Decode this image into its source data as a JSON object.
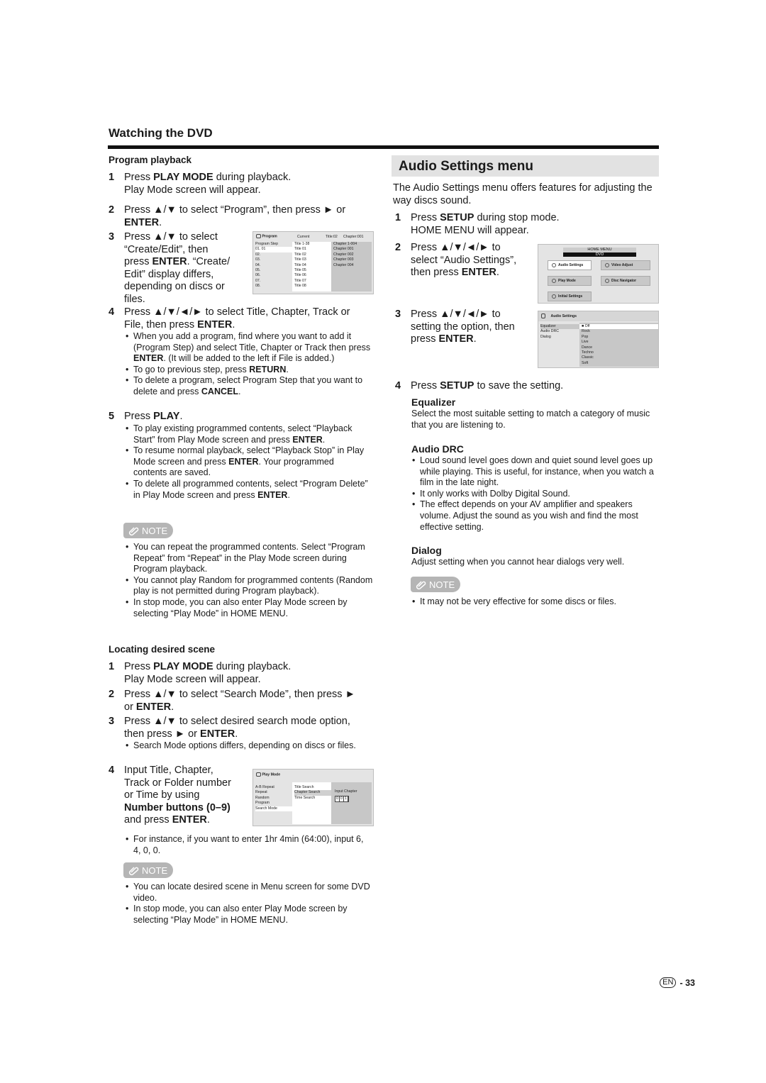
{
  "section_title": "Watching the DVD",
  "program_playback": {
    "title": "Program playback",
    "steps": [
      {
        "num": "1",
        "html": "Press <b>PLAY MODE</b> during playback.<br>Play Mode screen will appear."
      },
      {
        "num": "2",
        "html": "Press ▲/▼ to select “Program”, then press ► or<br><b>ENTER</b>."
      },
      {
        "num": "3",
        "html": "Press ▲/▼ to select<br>“Create/Edit”, then<br>press <b>ENTER</b>. “Create/<br>Edit” display differs,<br>depending on discs or<br>files."
      },
      {
        "num": "4",
        "html": "Press ▲/▼/◄/► to select Title, Chapter, Track or<br>File, then press <b>ENTER</b>."
      },
      {
        "num": "5",
        "html": "Press <b>PLAY</b>."
      }
    ],
    "step4_bullets": [
      "When you add a program, find where you want to add it (Program Step) and select Title, Chapter or Track then press <b>ENTER</b>. (It will be added to the left if File is added.)",
      "To go to previous step, press <b>RETURN</b>.",
      "To delete a program, select Program Step that you want to delete and press <b>CANCEL</b>."
    ],
    "step5_bullets": [
      "To play existing programmed contents, select “Playback Start” from Play Mode screen and press <b>ENTER</b>.",
      "To resume normal playback, select “Playback Stop” in Play Mode screen and press <b>ENTER</b>. Your programmed contents are saved.",
      "To delete all programmed contents, select “Program Delete” in Play Mode screen and press <b>ENTER</b>."
    ],
    "note_label": "NOTE",
    "note_bullets": [
      "You can repeat the programmed contents. Select “Program Repeat” from “Repeat” in the Play Mode screen during Program playback.",
      "You cannot play Random for programmed contents (Random play is not permitted during Program playback).",
      "In stop mode, you can also enter Play Mode screen by selecting “Play Mode” in HOME MENU."
    ],
    "screen": {
      "header": [
        "Program",
        "Current",
        "Title:02",
        "Chapter:001"
      ],
      "col1_header": "Program Step",
      "col1": [
        "01. 01",
        "02.",
        "03.",
        "04.",
        "05.",
        "06.",
        "07.",
        "08."
      ],
      "col2_header": "Title 1-38",
      "col2": [
        "Title 01",
        "Title 02",
        "Title 03",
        "Title 04",
        "Title 05",
        "Title 06",
        "Title 07",
        "Title 08"
      ],
      "col3_header": "Chapter 1-004",
      "col3": [
        "Chapter 001",
        "Chapter 002",
        "Chapter 003",
        "Chapter 004"
      ]
    }
  },
  "locating": {
    "title": "Locating desired scene",
    "steps": [
      {
        "num": "1",
        "html": "Press <b>PLAY MODE</b> during playback.<br>Play Mode screen will appear."
      },
      {
        "num": "2",
        "html": "Press ▲/▼ to select “Search Mode”, then press ►<br>or <b>ENTER</b>."
      },
      {
        "num": "3",
        "html": "Press ▲/▼ to select desired search mode option,<br>then press ► or <b>ENTER</b>."
      },
      {
        "num": "4",
        "html": "Input Title, Chapter,<br>Track or Folder number<br>or Time by using<br><b>Number buttons (0–9)</b><br>and press <b>ENTER</b>."
      }
    ],
    "step3_bullets": [
      "Search Mode options differs, depending on discs or files."
    ],
    "step4_bullets": [
      "For instance, if you want to enter 1hr 4min (64:00), input 6, 4, 0, 0."
    ],
    "note_label": "NOTE",
    "note_bullets": [
      "You can locate desired scene in Menu screen for some DVD video.",
      "In stop mode, you can also enter Play Mode screen by selecting “Play Mode” in HOME MENU."
    ],
    "screen": {
      "header": "Play Mode",
      "col1": [
        "A-B Repeat",
        "Repeat",
        "Random",
        "Program",
        "Search Mode"
      ],
      "col2": [
        "Title Search",
        "Chapter Search",
        "Time Search"
      ],
      "input_label": "Input Chapter",
      "input_digits": [
        "0",
        "0",
        "1"
      ]
    }
  },
  "audio_settings": {
    "title": "Audio Settings menu",
    "intro": "The Audio Settings menu offers features for adjusting the way discs sound.",
    "steps": [
      {
        "num": "1",
        "html": "Press <b>SETUP</b> during stop mode.<br>HOME MENU will appear."
      },
      {
        "num": "2",
        "html": "Press ▲/▼/◄/► to<br>select “Audio Settings”,<br>then press <b>ENTER</b>."
      },
      {
        "num": "3",
        "html": "Press ▲/▼/◄/► to<br>setting the option, then<br>press <b>ENTER</b>."
      },
      {
        "num": "4",
        "html": "Press <b>SETUP</b> to save the setting."
      }
    ],
    "equalizer_title": "Equalizer",
    "equalizer_text": "Select the most suitable setting to match a category of music that you are listening to.",
    "drc_title": "Audio DRC",
    "drc_bullets": [
      "Loud sound level goes down and quiet sound level goes up while playing. This is useful, for instance, when you watch a film in the late night.",
      "It only works with Dolby Digital Sound.",
      "The effect depends on your AV amplifier and speakers volume. Adjust the sound as you wish and find the most effective setting."
    ],
    "dialog_title": "Dialog",
    "dialog_text": "Adjust setting when you cannot hear dialogs very well.",
    "note_label": "NOTE",
    "note_bullets": [
      "It may not be very effective for some discs or files."
    ],
    "home_menu": {
      "title": "HOME MENU",
      "subtitle": "DVD",
      "buttons": [
        "Audio Settings",
        "Video Adjust",
        "Play Mode",
        "Disc Navigator",
        "Initial Settings"
      ]
    },
    "audio_screen": {
      "header": "Audio Settings",
      "left": [
        "Equalizer",
        "Audio DRC",
        "Dialog"
      ],
      "right": [
        "■ Off",
        "Rock",
        "Pop",
        "Live",
        "Dance",
        "Techno",
        "Classic",
        "Soft"
      ]
    }
  },
  "page": {
    "lang": "EN",
    "number": "- 33"
  }
}
